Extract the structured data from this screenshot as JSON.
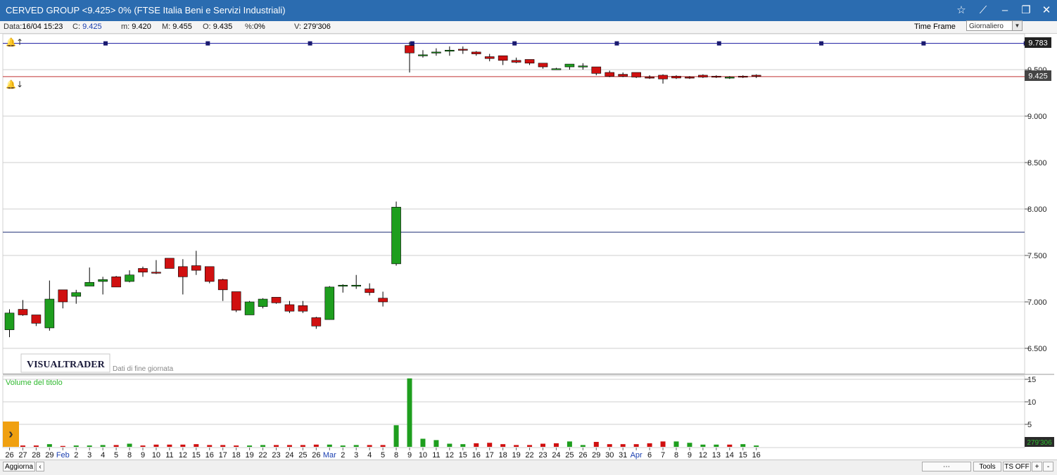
{
  "window": {
    "title": "CERVED GROUP <9.425> 0%  (FTSE Italia Beni e Servizi Industriali)",
    "star_icon": "☆",
    "pin_icon": "⟋",
    "minimize_icon": "–",
    "maximize_icon": "❐",
    "close_icon": "✕"
  },
  "info": {
    "data_label": "Data:",
    "data_value": "16/04 15:23",
    "c_label": "C:",
    "c_value": "9.425",
    "m_label": "m:",
    "m_value": "9.420",
    "max_label": "M:",
    "max_value": "9.455",
    "o_label": "O:",
    "o_value": "9.435",
    "pct_label": "%:",
    "pct_value": "0%",
    "v_label": "V:",
    "v_value": "279'306"
  },
  "timeframe": {
    "label": "Time Frame",
    "value": "Giornaliero"
  },
  "labels": {
    "logo": "VISUALTRADER",
    "subtitle": "Dati di fine giornata",
    "volume_title": "Volume del titolo",
    "top_line": "9.783",
    "last_price": "9.425",
    "last_volume": "279'306"
  },
  "bottombar": {
    "aggiorna": "Aggiorna",
    "tools": "Tools",
    "ts": "TS OFF",
    "plus": "+",
    "minus": "-"
  },
  "colors": {
    "up": "#1e9e1e",
    "down": "#d01010",
    "frame_blue": "#2b6cb0",
    "volume_label": "#2eb82e"
  },
  "chart_data": [
    {
      "type": "candlestick",
      "ylim": [
        6.4,
        9.9
      ],
      "y_ticks": [
        6.5,
        7.0,
        7.5,
        8.0,
        8.5,
        9.0,
        9.5
      ],
      "y_tick_labels": [
        "6.500",
        "7.000",
        "7.500",
        "8.000",
        "8.500",
        "9.000",
        "9.500"
      ],
      "x_tick_labels": [
        "26",
        "27",
        "28",
        "29",
        "Feb",
        "2",
        "3",
        "4",
        "5",
        "8",
        "9",
        "10",
        "11",
        "12",
        "15",
        "16",
        "17",
        "18",
        "19",
        "22",
        "23",
        "24",
        "25",
        "26",
        "Mar",
        "2",
        "3",
        "4",
        "5",
        "8",
        "9",
        "10",
        "11",
        "12",
        "15",
        "16",
        "17",
        "18",
        "19",
        "22",
        "23",
        "24",
        "25",
        "26",
        "29",
        "30",
        "31",
        "Apr",
        "6",
        "7",
        "8",
        "9",
        "12",
        "13",
        "14",
        "15",
        "16"
      ],
      "month_labels": [
        "Feb",
        "Mar",
        "Apr"
      ],
      "horizontal_lines": [
        {
          "value": 9.783,
          "color": "#1a1aa0"
        },
        {
          "value": 9.425,
          "color": "#c03030"
        },
        {
          "value": 7.75,
          "color": "#1a2a70"
        }
      ],
      "candles": [
        {
          "o": 6.7,
          "h": 6.92,
          "l": 6.62,
          "c": 6.88
        },
        {
          "o": 6.92,
          "h": 7.02,
          "l": 6.85,
          "c": 6.86
        },
        {
          "o": 6.86,
          "h": 6.86,
          "l": 6.74,
          "c": 6.77
        },
        {
          "o": 6.72,
          "h": 7.23,
          "l": 6.69,
          "c": 7.03
        },
        {
          "o": 7.13,
          "h": 7.13,
          "l": 6.93,
          "c": 7.0
        },
        {
          "o": 7.06,
          "h": 7.13,
          "l": 6.98,
          "c": 7.1
        },
        {
          "o": 7.17,
          "h": 7.37,
          "l": 7.17,
          "c": 7.21
        },
        {
          "o": 7.22,
          "h": 7.27,
          "l": 7.08,
          "c": 7.24
        },
        {
          "o": 7.27,
          "h": 7.28,
          "l": 7.16,
          "c": 7.16
        },
        {
          "o": 7.22,
          "h": 7.34,
          "l": 7.21,
          "c": 7.29
        },
        {
          "o": 7.36,
          "h": 7.38,
          "l": 7.27,
          "c": 7.32
        },
        {
          "o": 7.32,
          "h": 7.45,
          "l": 7.3,
          "c": 7.31
        },
        {
          "o": 7.47,
          "h": 7.47,
          "l": 7.36,
          "c": 7.36
        },
        {
          "o": 7.38,
          "h": 7.46,
          "l": 7.08,
          "c": 7.27
        },
        {
          "o": 7.39,
          "h": 7.55,
          "l": 7.29,
          "c": 7.34
        },
        {
          "o": 7.38,
          "h": 7.38,
          "l": 7.2,
          "c": 7.22
        },
        {
          "o": 7.24,
          "h": 7.25,
          "l": 7.01,
          "c": 7.13
        },
        {
          "o": 7.11,
          "h": 7.11,
          "l": 6.89,
          "c": 6.91
        },
        {
          "o": 6.86,
          "h": 7.01,
          "l": 6.86,
          "c": 7.0
        },
        {
          "o": 6.95,
          "h": 7.04,
          "l": 6.93,
          "c": 7.03
        },
        {
          "o": 7.05,
          "h": 7.05,
          "l": 6.98,
          "c": 6.99
        },
        {
          "o": 6.97,
          "h": 7.01,
          "l": 6.88,
          "c": 6.9
        },
        {
          "o": 6.96,
          "h": 7.01,
          "l": 6.88,
          "c": 6.9
        },
        {
          "o": 6.83,
          "h": 6.84,
          "l": 6.71,
          "c": 6.74
        },
        {
          "o": 6.81,
          "h": 7.17,
          "l": 6.81,
          "c": 7.16
        },
        {
          "o": 7.17,
          "h": 7.19,
          "l": 7.1,
          "c": 7.18
        },
        {
          "o": 7.18,
          "h": 7.29,
          "l": 7.14,
          "c": 7.18
        },
        {
          "o": 7.14,
          "h": 7.2,
          "l": 7.07,
          "c": 7.1
        },
        {
          "o": 7.04,
          "h": 7.11,
          "l": 6.95,
          "c": 7.0
        },
        {
          "o": 7.41,
          "h": 8.08,
          "l": 7.39,
          "c": 8.02
        },
        {
          "o": 9.76,
          "h": 9.8,
          "l": 9.47,
          "c": 9.68
        },
        {
          "o": 9.66,
          "h": 9.71,
          "l": 9.63,
          "c": 9.66
        },
        {
          "o": 9.69,
          "h": 9.73,
          "l": 9.65,
          "c": 9.69
        },
        {
          "o": 9.7,
          "h": 9.75,
          "l": 9.65,
          "c": 9.71
        },
        {
          "o": 9.72,
          "h": 9.75,
          "l": 9.67,
          "c": 9.71
        },
        {
          "o": 9.69,
          "h": 9.7,
          "l": 9.65,
          "c": 9.67
        },
        {
          "o": 9.64,
          "h": 9.67,
          "l": 9.59,
          "c": 9.62
        },
        {
          "o": 9.65,
          "h": 9.65,
          "l": 9.55,
          "c": 9.6
        },
        {
          "o": 9.6,
          "h": 9.63,
          "l": 9.57,
          "c": 9.58
        },
        {
          "o": 9.61,
          "h": 9.61,
          "l": 9.55,
          "c": 9.57
        },
        {
          "o": 9.57,
          "h": 9.57,
          "l": 9.51,
          "c": 9.53
        },
        {
          "o": 9.51,
          "h": 9.52,
          "l": 9.5,
          "c": 9.51
        },
        {
          "o": 9.53,
          "h": 9.56,
          "l": 9.5,
          "c": 9.56
        },
        {
          "o": 9.54,
          "h": 9.57,
          "l": 9.5,
          "c": 9.54
        },
        {
          "o": 9.53,
          "h": 9.53,
          "l": 9.44,
          "c": 9.46
        },
        {
          "o": 9.47,
          "h": 9.49,
          "l": 9.42,
          "c": 9.43
        },
        {
          "o": 9.45,
          "h": 9.47,
          "l": 9.42,
          "c": 9.43
        },
        {
          "o": 9.47,
          "h": 9.47,
          "l": 9.41,
          "c": 9.42
        },
        {
          "o": 9.42,
          "h": 9.44,
          "l": 9.4,
          "c": 9.41
        },
        {
          "o": 9.44,
          "h": 9.45,
          "l": 9.35,
          "c": 9.4
        },
        {
          "o": 9.43,
          "h": 9.44,
          "l": 9.4,
          "c": 9.41
        },
        {
          "o": 9.42,
          "h": 9.43,
          "l": 9.4,
          "c": 9.41
        },
        {
          "o": 9.44,
          "h": 9.45,
          "l": 9.41,
          "c": 9.42
        },
        {
          "o": 9.43,
          "h": 9.44,
          "l": 9.41,
          "c": 9.42
        },
        {
          "o": 9.41,
          "h": 9.43,
          "l": 9.4,
          "c": 9.42
        },
        {
          "o": 9.43,
          "h": 9.44,
          "l": 9.41,
          "c": 9.42
        },
        {
          "o": 9.44,
          "h": 9.45,
          "l": 9.41,
          "c": 9.43
        }
      ]
    },
    {
      "type": "bar",
      "title": "Volume del titolo",
      "ylim": [
        0,
        16
      ],
      "y_ticks": [
        5,
        10,
        15
      ],
      "y_tick_labels": [
        "5",
        "10",
        "15"
      ],
      "values": [
        0.3,
        0.3,
        0.3,
        0.6,
        0.2,
        0.3,
        0.3,
        0.4,
        0.4,
        0.7,
        0.3,
        0.5,
        0.5,
        0.5,
        0.6,
        0.4,
        0.4,
        0.3,
        0.3,
        0.4,
        0.4,
        0.4,
        0.4,
        0.5,
        0.5,
        0.3,
        0.4,
        0.4,
        0.4,
        4.8,
        15.2,
        1.8,
        1.5,
        0.7,
        0.6,
        0.8,
        0.9,
        0.6,
        0.4,
        0.4,
        0.7,
        0.8,
        1.2,
        0.4,
        1.1,
        0.6,
        0.6,
        0.6,
        0.8,
        1.2,
        1.2,
        0.9,
        0.5,
        0.5,
        0.5,
        0.6,
        0.3
      ],
      "directions": [
        "u",
        "d",
        "d",
        "u",
        "d",
        "u",
        "u",
        "u",
        "d",
        "u",
        "d",
        "d",
        "d",
        "d",
        "d",
        "d",
        "d",
        "d",
        "u",
        "u",
        "d",
        "d",
        "d",
        "d",
        "u",
        "u",
        "u",
        "d",
        "d",
        "u",
        "u",
        "u",
        "u",
        "u",
        "u",
        "d",
        "d",
        "d",
        "d",
        "d",
        "d",
        "d",
        "u",
        "u",
        "d",
        "d",
        "d",
        "d",
        "d",
        "d",
        "u",
        "u",
        "u",
        "u",
        "d",
        "u",
        "u"
      ]
    }
  ]
}
